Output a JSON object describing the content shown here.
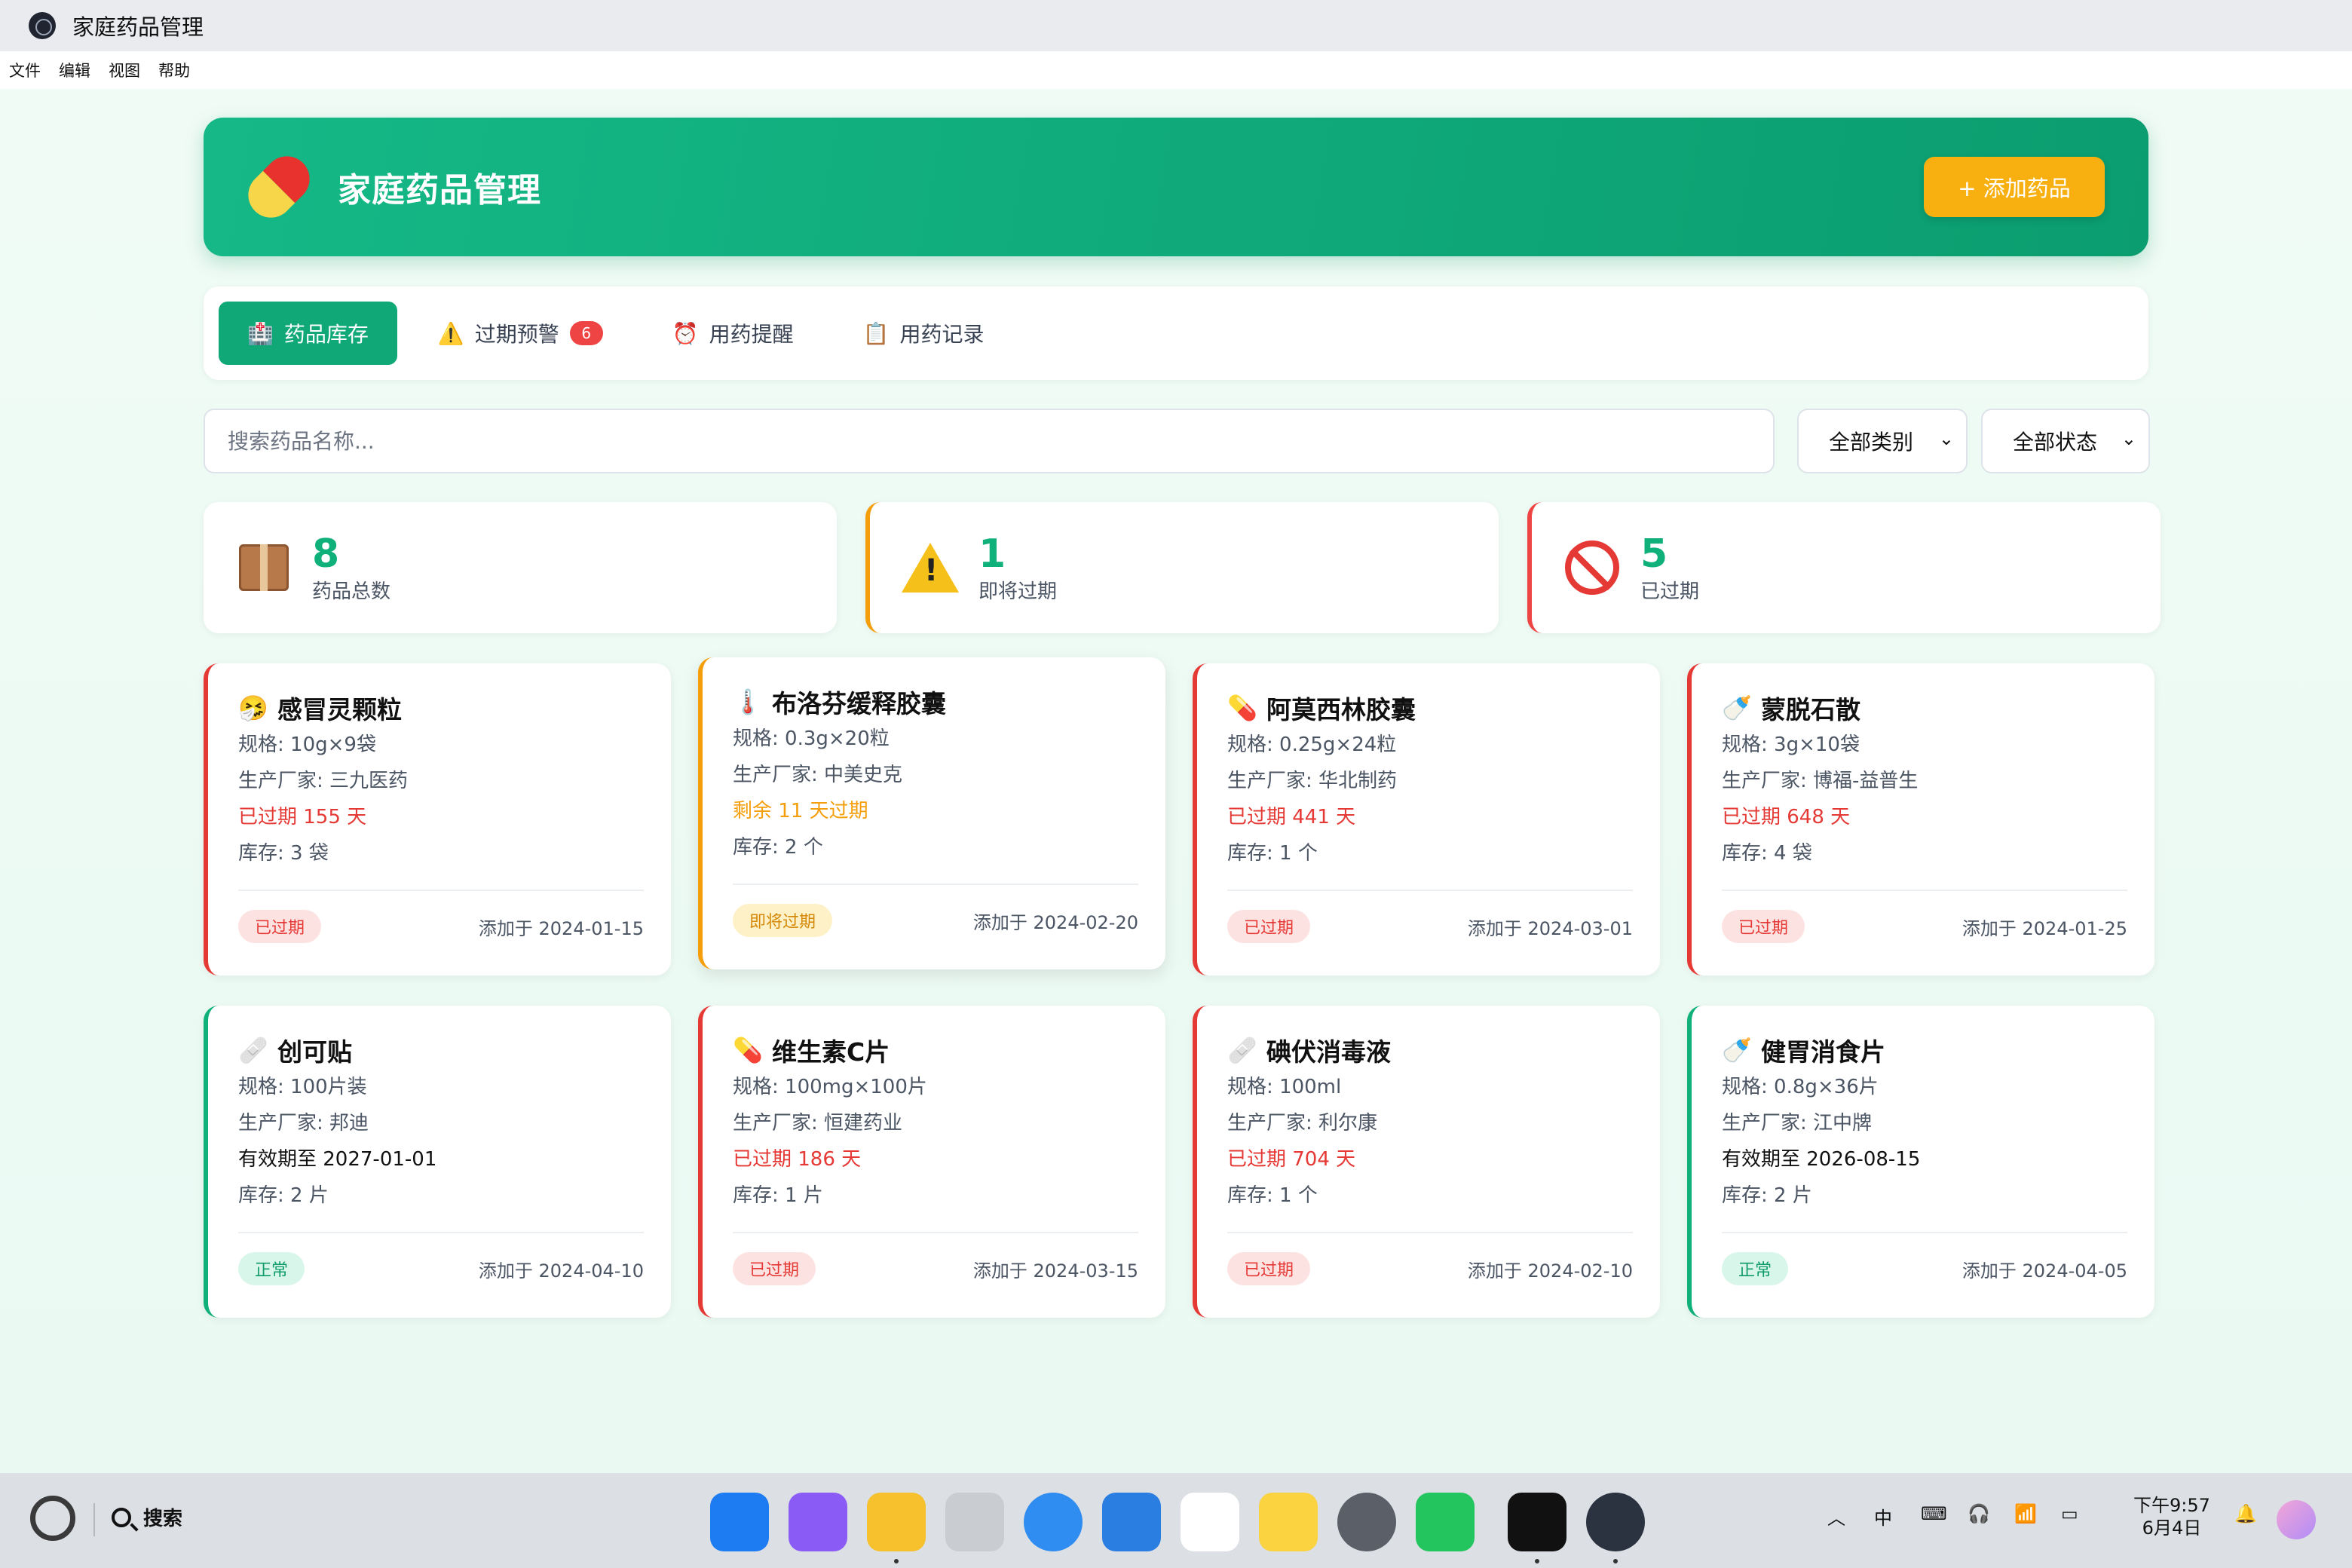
{
  "window": {
    "title": "家庭药品管理"
  },
  "menu": [
    "文件",
    "编辑",
    "视图",
    "帮助"
  ],
  "header": {
    "title": "家庭药品管理",
    "add_button": "+ 添加药品"
  },
  "tabs": [
    {
      "label": "药品库存",
      "icon": "hospital-icon",
      "active": true
    },
    {
      "label": "过期预警",
      "icon": "warning-icon",
      "badge": "6"
    },
    {
      "label": "用药提醒",
      "icon": "alarm-clock-icon"
    },
    {
      "label": "用药记录",
      "icon": "clipboard-icon"
    }
  ],
  "search": {
    "placeholder": "搜索药品名称..."
  },
  "filters": {
    "category": "全部类别",
    "status": "全部状态"
  },
  "stats": [
    {
      "value": "8",
      "label": "药品总数",
      "icon": "box-icon"
    },
    {
      "value": "1",
      "label": "即将过期",
      "icon": "warning-icon"
    },
    {
      "value": "5",
      "label": "已过期",
      "icon": "prohibited-icon"
    }
  ],
  "medicines": [
    {
      "name": "感冒灵颗粒",
      "icon": "sick-face-icon",
      "spec": "规格: 10g×9袋",
      "maker": "生产厂家: 三九医药",
      "expiry": "已过期 155 天",
      "stock": "库存: 3 袋",
      "status": "已过期",
      "added": "添加于 2024-01-15"
    },
    {
      "name": "布洛芬缓释胶囊",
      "icon": "thermometer-icon",
      "spec": "规格: 0.3g×20粒",
      "maker": "生产厂家: 中美史克",
      "expiry": "剩余 11 天过期",
      "stock": "库存: 2 个",
      "status": "即将过期",
      "added": "添加于 2024-02-20"
    },
    {
      "name": "阿莫西林胶囊",
      "icon": "pill-icon",
      "spec": "规格: 0.25g×24粒",
      "maker": "生产厂家: 华北制药",
      "expiry": "已过期 441 天",
      "stock": "库存: 1 个",
      "status": "已过期",
      "added": "添加于 2024-03-01"
    },
    {
      "name": "蒙脱石散",
      "icon": "baby-bottle-icon",
      "spec": "规格: 3g×10袋",
      "maker": "生产厂家: 博福-益普生",
      "expiry": "已过期 648 天",
      "stock": "库存: 4 袋",
      "status": "已过期",
      "added": "添加于 2024-01-25"
    },
    {
      "name": "创可贴",
      "icon": "bandage-icon",
      "spec": "规格: 100片装",
      "maker": "生产厂家: 邦迪",
      "expiry": "有效期至 2027-01-01",
      "stock": "库存: 2 片",
      "status": "正常",
      "added": "添加于 2024-04-10"
    },
    {
      "name": "维生素C片",
      "icon": "pill-icon",
      "spec": "规格: 100mg×100片",
      "maker": "生产厂家: 恒建药业",
      "expiry": "已过期 186 天",
      "stock": "库存: 1 片",
      "status": "已过期",
      "added": "添加于 2024-03-15"
    },
    {
      "name": "碘伏消毒液",
      "icon": "bandage-icon",
      "spec": "规格: 100ml",
      "maker": "生产厂家: 利尔康",
      "expiry": "已过期 704 天",
      "stock": "库存: 1 个",
      "status": "已过期",
      "added": "添加于 2024-02-10"
    },
    {
      "name": "健胃消食片",
      "icon": "baby-bottle-icon",
      "spec": "规格: 0.8g×36片",
      "maker": "生产厂家: 江中牌",
      "expiry": "有效期至 2026-08-15",
      "stock": "库存: 2 片",
      "status": "正常",
      "added": "添加于 2024-04-05"
    }
  ],
  "taskbar": {
    "search_label": "搜索",
    "ime": "中",
    "time": "下午9:57",
    "date": "6月4日"
  },
  "colors": {
    "primary": "#11a877",
    "accent": "#f7b00f",
    "expired": "#e53935",
    "warning": "#f59e0b"
  }
}
